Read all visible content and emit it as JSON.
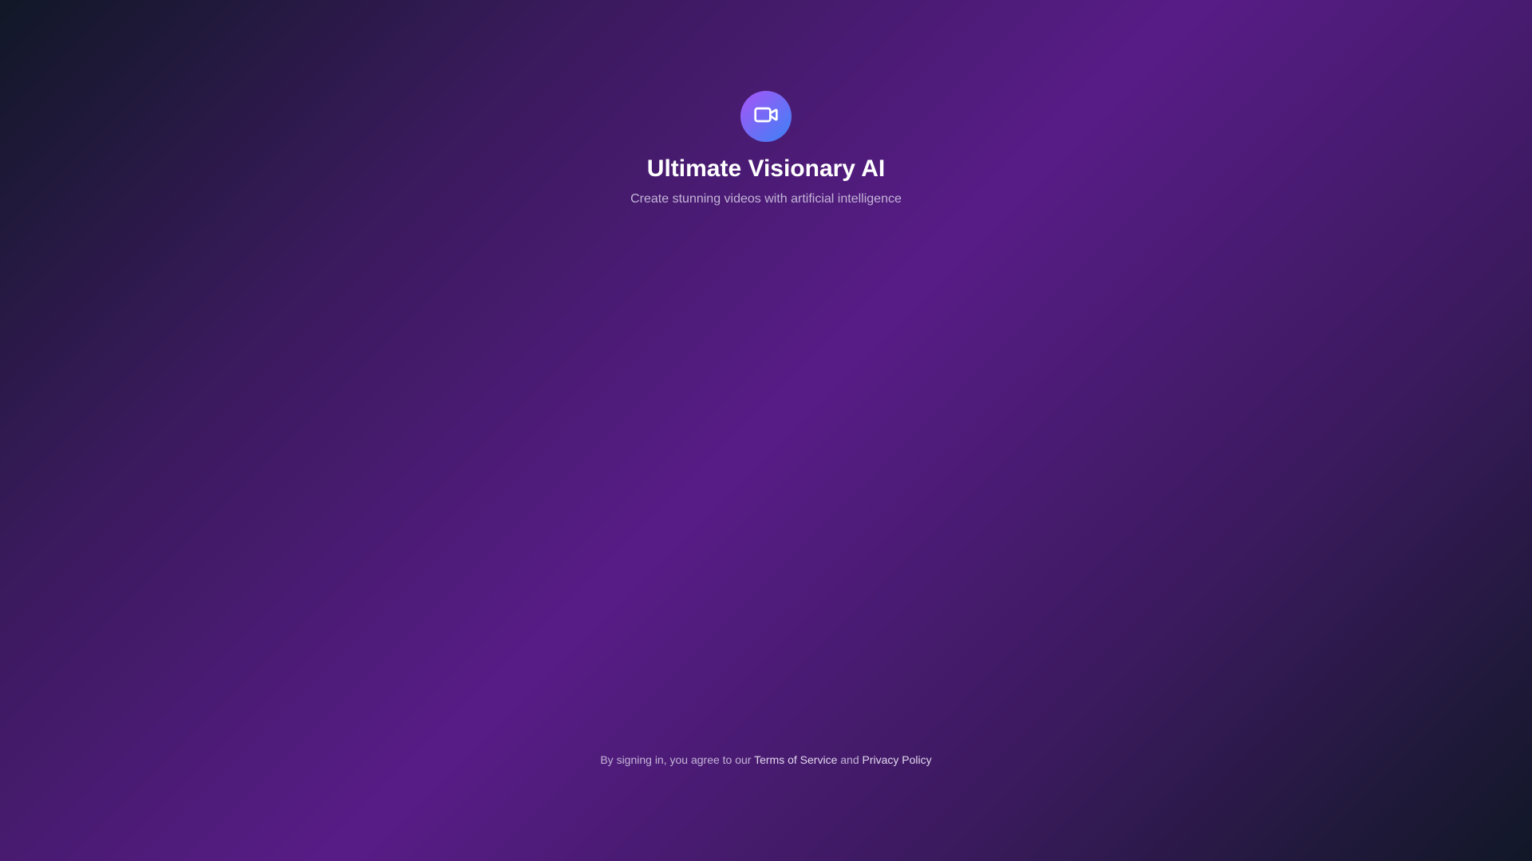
{
  "app": {
    "title": "Ultimate Visionary AI",
    "subtitle": "Create stunning videos with artificial intelligence",
    "logo_icon": "video-camera-icon"
  },
  "footer": {
    "prefix": "By signing in, you agree to our ",
    "terms_label": "Terms of Service",
    "conjunction": " and ",
    "privacy_label": "Privacy Policy"
  },
  "colors": {
    "background_dark": "#111827",
    "background_purple": "#581c87",
    "logo_gradient_start": "#a855f7",
    "logo_gradient_end": "#3b82f6",
    "text_primary": "#ffffff",
    "text_muted": "#c4b5d8"
  }
}
